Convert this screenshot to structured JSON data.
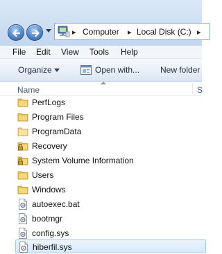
{
  "address": {
    "crumbs": [
      "Computer",
      "Local Disk (C:)"
    ]
  },
  "menu": {
    "items": [
      "File",
      "Edit",
      "View",
      "Tools",
      "Help"
    ]
  },
  "toolbar": {
    "organize_label": "Organize",
    "open_with_label": "Open with...",
    "new_folder_label": "New folder"
  },
  "columns": {
    "name": "Name",
    "next": "S"
  },
  "files": [
    {
      "name": "PerfLogs",
      "kind": "folder"
    },
    {
      "name": "Program Files",
      "kind": "folder"
    },
    {
      "name": "ProgramData",
      "kind": "folder"
    },
    {
      "name": "Recovery",
      "kind": "locked-folder"
    },
    {
      "name": "System Volume Information",
      "kind": "locked-folder"
    },
    {
      "name": "Users",
      "kind": "folder"
    },
    {
      "name": "Windows",
      "kind": "folder"
    },
    {
      "name": "autoexec.bat",
      "kind": "file"
    },
    {
      "name": "bootmgr",
      "kind": "file"
    },
    {
      "name": "config.sys",
      "kind": "file"
    },
    {
      "name": "hiberfil.sys",
      "kind": "file",
      "selected": true
    }
  ],
  "colors": {
    "selection": "#d8e9fb",
    "folder": "#e8c15a",
    "accent": "#2a5aa6"
  }
}
